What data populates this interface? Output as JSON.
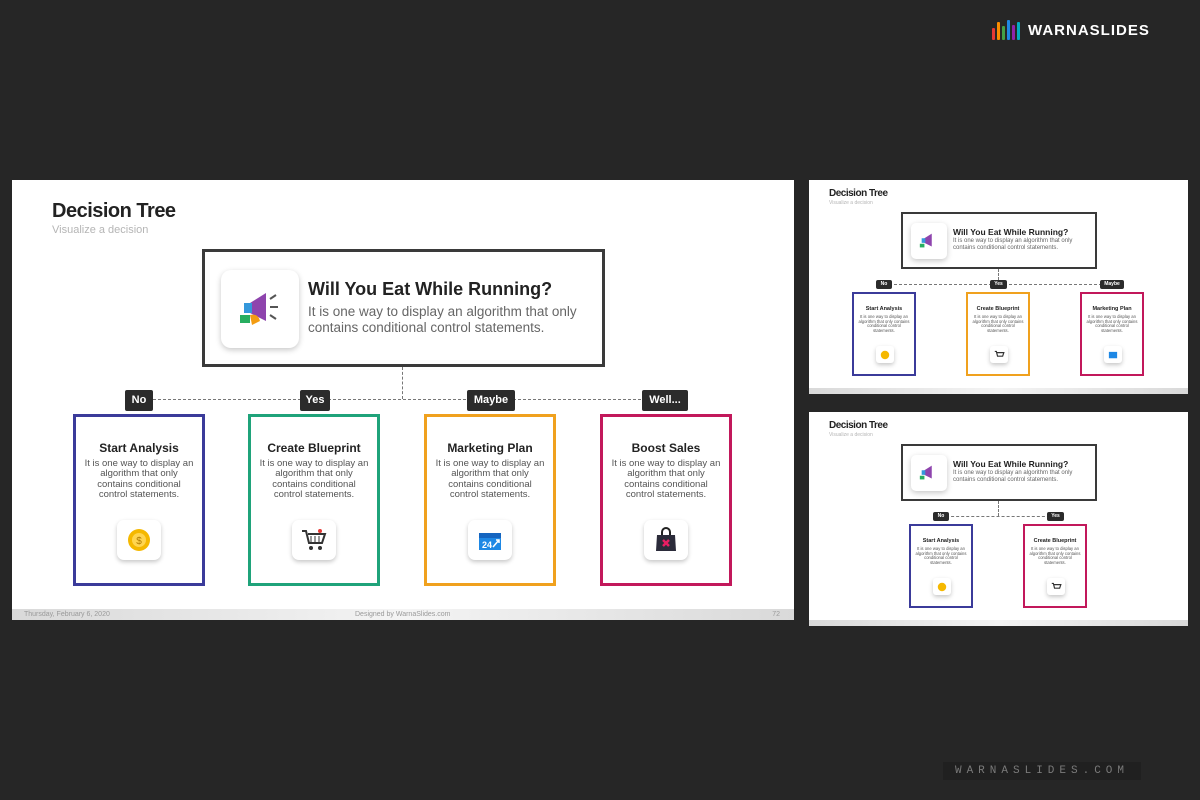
{
  "brand": {
    "name": "WARNASLIDES",
    "footer_text": "WARNASLIDES.COM",
    "bar_colors": [
      "#e53935",
      "#fb8c00",
      "#43a047",
      "#1e88e5",
      "#8e24aa",
      "#00acc1"
    ]
  },
  "colors": {
    "no": "#3b3b9a",
    "yes": "#1fa37a",
    "maybe": "#f0a11e",
    "well": "#c2185b"
  },
  "main_slide": {
    "title": "Decision Tree",
    "subtitle": "Visualize a decision",
    "question": {
      "title": "Will You Eat While Running?",
      "description": "It is one way to display an algorithm that only contains conditional control statements.",
      "icon": "megaphone-icon"
    },
    "branches": [
      {
        "tag": "No",
        "title": "Start Analysis",
        "description": "It is one way to display an algorithm that only contains conditional control statements.",
        "icon": "coin-icon"
      },
      {
        "tag": "Yes",
        "title": "Create Blueprint",
        "description": "It is one way to display an algorithm that only contains conditional control statements.",
        "icon": "shopping-cart-icon"
      },
      {
        "tag": "Maybe",
        "title": "Marketing Plan",
        "description": "It is one way to display an algorithm that only contains conditional control statements.",
        "icon": "calendar-24-icon"
      },
      {
        "tag": "Well...",
        "title": "Boost Sales",
        "description": "It is one way to display an algorithm that only contains conditional control statements.",
        "icon": "shopping-bag-icon"
      }
    ],
    "footer": {
      "date": "Thursday, February 6, 2020",
      "credit": "Designed by WarnaSlides.com",
      "page": "72"
    }
  },
  "thumb_a": {
    "title": "Decision Tree",
    "subtitle": "Visualize a decision",
    "question": {
      "title": "Will You Eat While Running?",
      "description": "It is one way to display an algorithm that only contains conditional control statements."
    },
    "branches": [
      {
        "tag": "No",
        "title": "Start Analysis",
        "description": "It is one way to display an algorithm that only contains conditional control statements."
      },
      {
        "tag": "Yes",
        "title": "Create Blueprint",
        "description": "It is one way to display an algorithm that only contains conditional control statements."
      },
      {
        "tag": "Maybe",
        "title": "Marketing Plan",
        "description": "It is one way to display an algorithm that only contains conditional control statements."
      }
    ]
  },
  "thumb_b": {
    "title": "Decision Tree",
    "subtitle": "Visualize a decision",
    "question": {
      "title": "Will You Eat While Running?",
      "description": "It is one way to display an algorithm that only contains conditional control statements."
    },
    "branches": [
      {
        "tag": "No",
        "title": "Start Analysis",
        "description": "It is one way to display an algorithm that only contains conditional control statements."
      },
      {
        "tag": "Yes",
        "title": "Create Blueprint",
        "description": "It is one way to display an algorithm that only contains conditional control statements."
      }
    ]
  }
}
